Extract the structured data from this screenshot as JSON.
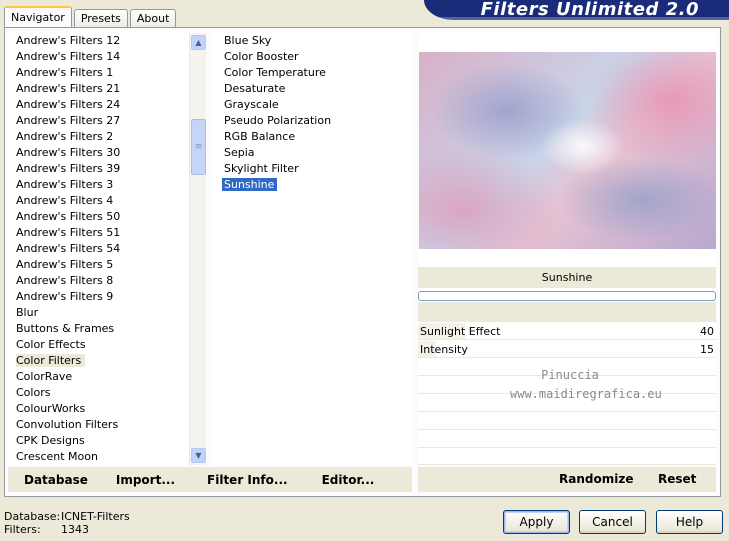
{
  "window": {
    "title": "Filters Unlimited 2.0"
  },
  "tabs": [
    {
      "label": "Navigator",
      "active": true
    },
    {
      "label": "Presets",
      "active": false
    },
    {
      "label": "About",
      "active": false
    }
  ],
  "categories": {
    "items": [
      "Andrew's Filters 12",
      "Andrew's Filters 14",
      "Andrew's Filters 1",
      "Andrew's Filters 21",
      "Andrew's Filters 24",
      "Andrew's Filters 27",
      "Andrew's Filters 2",
      "Andrew's Filters 30",
      "Andrew's Filters 39",
      "Andrew's Filters 3",
      "Andrew's Filters 4",
      "Andrew's Filters 50",
      "Andrew's Filters 51",
      "Andrew's Filters 54",
      "Andrew's Filters 5",
      "Andrew's Filters 8",
      "Andrew's Filters 9",
      "Blur",
      "Buttons & Frames",
      "Color Effects",
      "Color Filters",
      "ColorRave",
      "Colors",
      "ColourWorks",
      "Convolution Filters",
      "CPK Designs",
      "Crescent Moon"
    ],
    "selected": "Color Filters"
  },
  "filters": {
    "items": [
      "Blue Sky",
      "Color Booster",
      "Color Temperature",
      "Desaturate",
      "Grayscale",
      "Pseudo Polarization",
      "RGB Balance",
      "Sepia",
      "Skylight Filter",
      "Sunshine"
    ],
    "selected": "Sunshine"
  },
  "preview": {
    "filter_name": "Sunshine"
  },
  "parameters": [
    {
      "label": "Sunlight Effect",
      "value": "40",
      "level": 0.157
    },
    {
      "label": "Intensity",
      "value": "15",
      "level": 0.059
    }
  ],
  "watermark": {
    "line1": "Pinuccia",
    "line2": "www.maidiregrafica.eu"
  },
  "toolbar": {
    "database": "Database",
    "import": "Import...",
    "filter_info": "Filter Info...",
    "editor": "Editor...",
    "randomize": "Randomize",
    "reset": "Reset"
  },
  "status": {
    "database_label": "Database:",
    "database_value": "ICNET-Filters",
    "filters_label": "Filters:",
    "filters_value": "1343"
  },
  "buttons": {
    "apply": "Apply",
    "cancel": "Cancel",
    "help": "Help"
  },
  "colors": {
    "banner": "#1a2b7a",
    "selection": "#316ac5",
    "dialog_bg": "#ece9d8"
  }
}
